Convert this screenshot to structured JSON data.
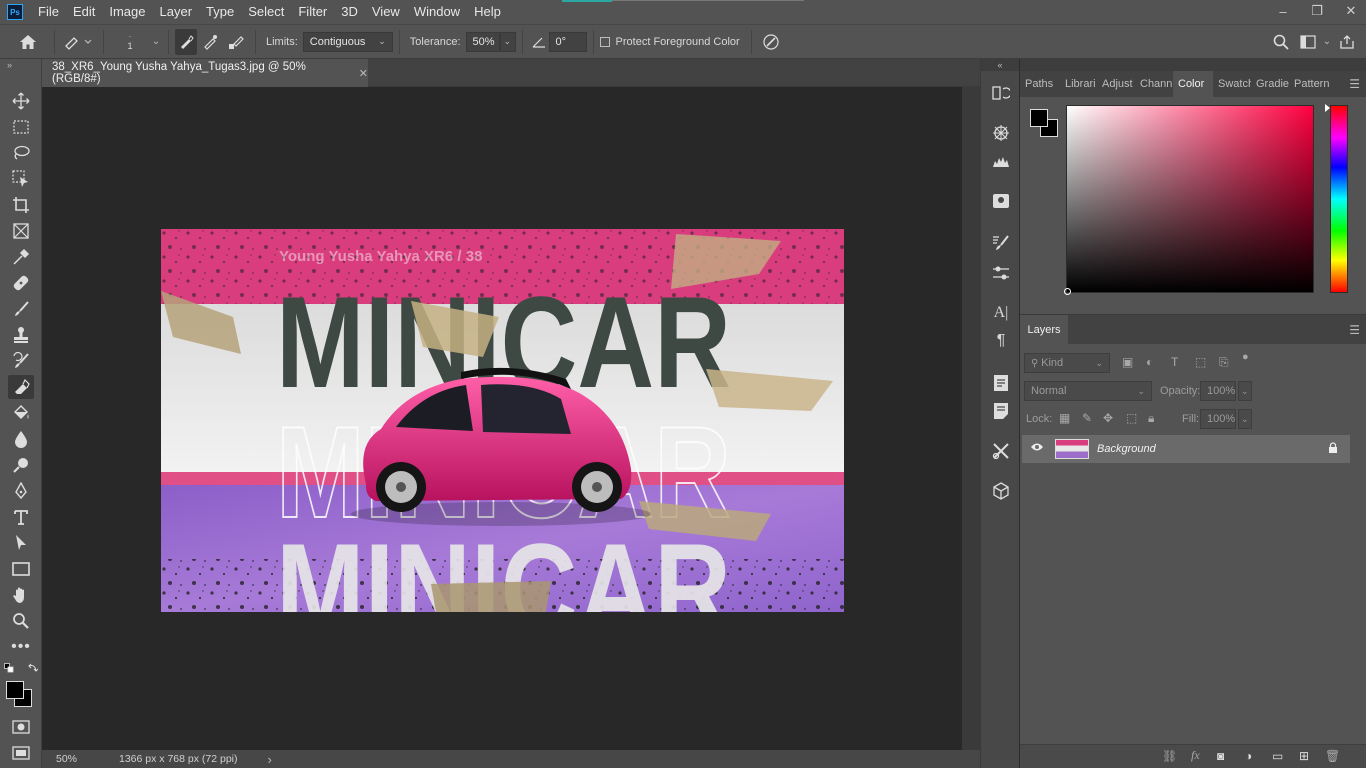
{
  "menu": [
    "File",
    "Edit",
    "Image",
    "Layer",
    "Type",
    "Select",
    "Filter",
    "3D",
    "View",
    "Window",
    "Help"
  ],
  "app_logo": "Ps",
  "window_controls": {
    "minimize": "–",
    "restore": "❐",
    "close": "✕"
  },
  "options": {
    "brush_size": "1",
    "limits_label": "Limits:",
    "limits_value": "Contiguous",
    "tolerance_label": "Tolerance:",
    "tolerance_value": "50%",
    "angle_value": "0°",
    "protect_label": "Protect Foreground Color"
  },
  "document": {
    "tab_title": "38_XR6_Young Yusha Yahya_Tugas3.jpg @ 50% (RGB/8#)",
    "close": "✕",
    "zoom": "50%",
    "doc_info": "1366 px x 768 px (72 ppi)",
    "status_arrow": "›"
  },
  "artwork": {
    "credit": "Young Yusha Yahya XR6 / 38",
    "headline": "MINICAR",
    "colors": {
      "pink": "#d93d7e",
      "band_pink": "#e04f86",
      "light": "#e6e6e6",
      "purple": "#9b6fd0"
    }
  },
  "panels": {
    "tabs": [
      "Paths",
      "Librari",
      "Adjust",
      "Chann",
      "Color",
      "Swatch",
      "Gradie",
      "Pattern"
    ],
    "active_tab": "Color",
    "layers_tab": "Layers",
    "kind_placeholder": "Kind",
    "blend_mode": "Normal",
    "opacity_label": "Opacity:",
    "opacity_value": "100%",
    "lock_label": "Lock:",
    "fill_label": "Fill:",
    "fill_value": "100%",
    "layer_name": "Background"
  },
  "accent_colors": {
    "ui_dark": "#535353",
    "canvas_bg": "#282828",
    "picker_hue": "#ff0040"
  }
}
